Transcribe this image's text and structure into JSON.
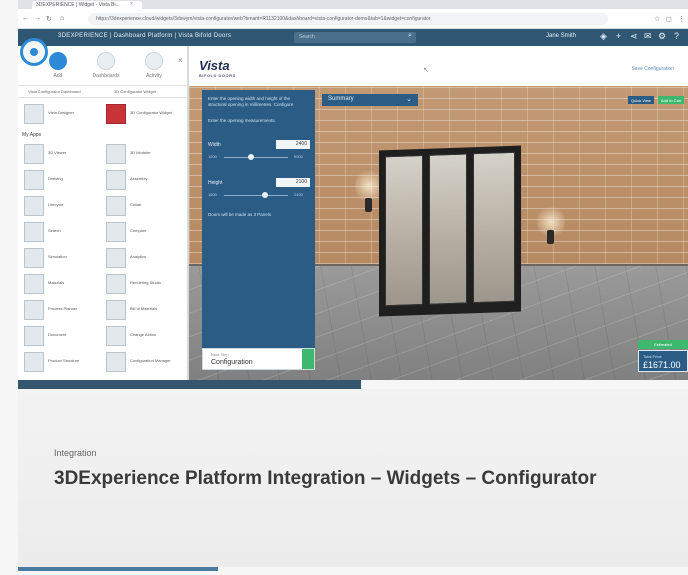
{
  "browser": {
    "tab_title": "3DEXPERIENCE | Widget · Vista Bi...",
    "url": "https://3dexperience.cloud/widgets/3dswym/vista-configurator/web?tenant=R1132100&dashboard=vista-configurator-demo&tab=1&widget=configurator"
  },
  "appbar": {
    "brand": "3DEXPERIENCE | Dashboard Platform | Vista Bifold Doors",
    "search_placeholder": "Search",
    "user": "Jane Smith"
  },
  "widget_panel": {
    "tabs": [
      {
        "label": "Add"
      },
      {
        "label": "Dashboards"
      },
      {
        "label": "Activity"
      }
    ],
    "subtabs": [
      "Vista Configurator Dashboard",
      "3D Configurator Widget"
    ],
    "featured": [
      {
        "label": "Vista Designer"
      },
      {
        "label": "3D Configurator Widget"
      }
    ],
    "section_label": "My Apps",
    "widgets": [
      {
        "label": "3D Viewer"
      },
      {
        "label": "3D Modeler"
      },
      {
        "label": "Drawing"
      },
      {
        "label": "Assembly"
      },
      {
        "label": "Lifecycle"
      },
      {
        "label": "Collab"
      },
      {
        "label": "Search"
      },
      {
        "label": "Compare"
      },
      {
        "label": "Simulation"
      },
      {
        "label": "Analytics"
      },
      {
        "label": "Materials"
      },
      {
        "label": "Rendering Studio"
      },
      {
        "label": "Process Planner"
      },
      {
        "label": "Bill of Materials"
      },
      {
        "label": "Document"
      },
      {
        "label": "Change Action"
      },
      {
        "label": "Product Structure"
      },
      {
        "label": "Configuration Manager"
      }
    ]
  },
  "vista": {
    "logo": "Vista",
    "logo_sub": "BIFOLD DOORS",
    "link": "Save Configuration"
  },
  "configurator": {
    "dropdown": "Summary",
    "intro": "Enter the opening width and height of the structural opening in millimetres. Configure",
    "intro2": "Enter the opening measurements.",
    "width_label": "Width",
    "width_value": "2400",
    "width_min": "1200",
    "width_max": "6000",
    "height_label": "Height",
    "height_value": "2100",
    "height_min": "1800",
    "height_max": "2400",
    "panels_note": "Doors will be made as 3 Panels",
    "footer_small": "Next Step",
    "footer_big": "Configuration"
  },
  "overlays": {
    "btn_left": "Quick View",
    "btn_right": "Add to Cart",
    "price_tag": "Estimated",
    "price_label": "Total Price",
    "price": "£1671.00"
  },
  "slide": {
    "eyebrow": "Integration",
    "title": "3DExperience Platform Integration – Widgets – Configurator"
  },
  "colors": {
    "app_blue": "#2f5673",
    "config_blue": "#2b5c86",
    "accent_green": "#3fb86f",
    "compass_blue": "#2c8ad6"
  }
}
